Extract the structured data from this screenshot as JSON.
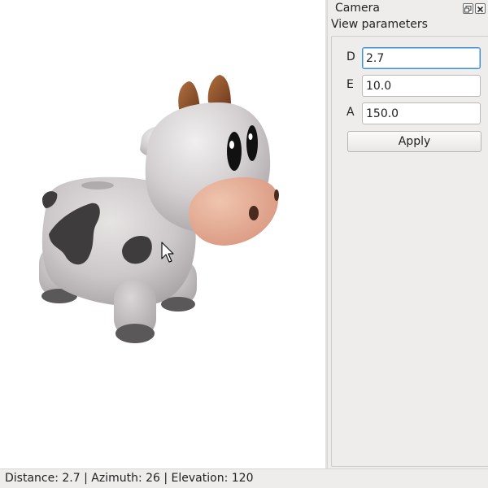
{
  "dock": {
    "title": "Camera",
    "float_icon": "float-window-icon",
    "close_icon": "close-icon"
  },
  "view_parameters": {
    "title": "View parameters",
    "fields": [
      {
        "label": "D",
        "value": "2.7"
      },
      {
        "label": "E",
        "value": "10.0"
      },
      {
        "label": "A",
        "value": "150.0"
      }
    ],
    "apply_label": "Apply"
  },
  "viewport": {
    "subject": "3D cow model",
    "cursor_icon": "mouse-pointer-icon"
  },
  "statusbar": {
    "text": "Distance: 2.7 | Azimuth: 26 | Elevation: 120"
  },
  "colors": {
    "accent_focus": "#3b8fd6",
    "panel_bg": "#efedeb",
    "viewport_bg": "#ffffff"
  }
}
